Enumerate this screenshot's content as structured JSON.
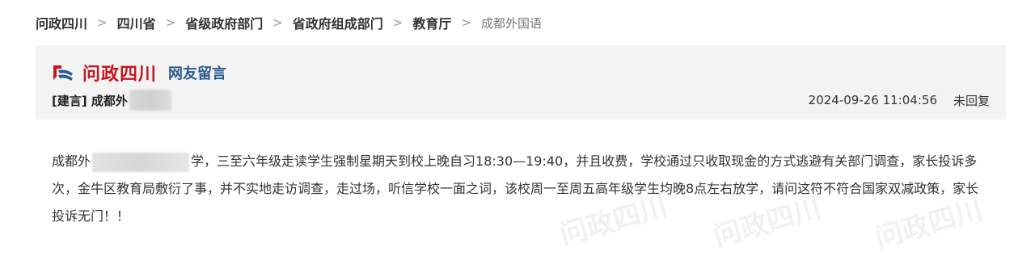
{
  "breadcrumb": {
    "items": [
      "问政四川",
      "四川省",
      "省级政府部门",
      "省政府组成部门",
      "教育厅"
    ],
    "current": "成都外国语",
    "separator": ">"
  },
  "header": {
    "logo_text": "问政四川",
    "logo_sub": "网友留言",
    "title": "[建言] 成都外",
    "datetime": "2024-09-26 11:04:56",
    "status": "未回复"
  },
  "content": {
    "prefix": "成都外",
    "body": "学，三至六年级走读学生强制星期天到校上晚自习18:30—19:40，并且收费，学校通过只收取现金的方式逃避有关部门调查，家长投诉多次，金牛区教育局敷衍了事，并不实地走访调查，走过场，听信学校一面之词，该校周一至周五高年级学生均晚8点左右放学，请问这符不符合国家双减政策，家长投诉无门！！"
  },
  "watermark": {
    "text": "问政四川"
  },
  "colors": {
    "brand_red": "#c8161d",
    "brand_blue": "#2a5a8f",
    "card_bg": "#f3f3f3"
  }
}
